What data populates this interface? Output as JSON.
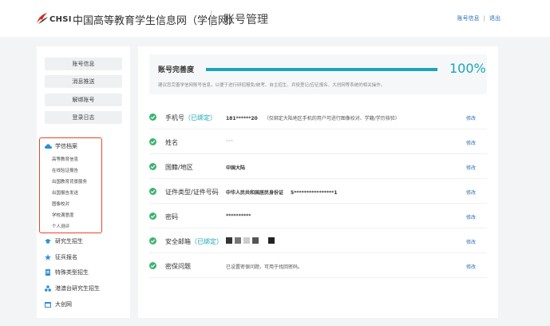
{
  "header": {
    "logo_text": "CHSI",
    "site_name": "中国高等教育学生信息网（学信网）",
    "page_title": "账号管理",
    "links": [
      "账号信息",
      "退出"
    ],
    "separator": "|"
  },
  "sidebar": {
    "buttons": [
      "账号信息",
      "消息推送",
      "解绑账号",
      "登录日志"
    ],
    "archive": {
      "title": "学信档案",
      "items": [
        "高等教育信息",
        "在线验证报告",
        "出国教育背景服务",
        "出国报告发送",
        "图像校对",
        "学校满意度",
        "个人测评"
      ]
    },
    "links": [
      {
        "label": "研究生招生",
        "icon": "graduation-cap-icon"
      },
      {
        "label": "征兵报名",
        "icon": "star-icon"
      },
      {
        "label": "特殊类型招生",
        "icon": "document-icon"
      },
      {
        "label": "港澳台研究生招生",
        "icon": "network-icon"
      },
      {
        "label": "大创网",
        "icon": "calendar-icon"
      }
    ]
  },
  "completion": {
    "label": "账号完善度",
    "percent_text": "100%",
    "progress": 1.0,
    "note": "建议您完善学信网账号信息，以便于进行研招报免/统考、自主招生、兵役登记/应征报名、大创网等系统的相关操作。"
  },
  "rows": [
    {
      "label": "手机号",
      "bound": "（已绑定）",
      "value": "181******20",
      "note": "（仅绑定大陆地区手机的用户可进行图像校对、学籍/学历核验）",
      "edit": "修改"
    },
    {
      "label": "姓名",
      "bound": "",
      "value": "***",
      "note": "",
      "edit": "修改"
    },
    {
      "label": "国籍/地区",
      "bound": "",
      "value": "中国大陆",
      "note": "",
      "edit": "修改"
    },
    {
      "label": "证件类型/证件号码",
      "bound": "",
      "value": "中华人民共和国居民身份证",
      "value2": "5****************1",
      "note": "",
      "edit": "修改"
    },
    {
      "label": "密码",
      "bound": "",
      "value": "**********",
      "note": "",
      "edit": "修改"
    },
    {
      "label": "安全邮箱",
      "bound": "（已绑定）",
      "value": "",
      "note": "",
      "edit": "修改"
    },
    {
      "label": "密保问题",
      "bound": "",
      "value": "已设置密保问题，可用于找回密码。",
      "note": "",
      "edit": "修改"
    }
  ],
  "colors": {
    "accent": "#1ba5b8",
    "link": "#2f6eb5",
    "highlight_border": "#e8452c",
    "check": "#3cb46e"
  }
}
